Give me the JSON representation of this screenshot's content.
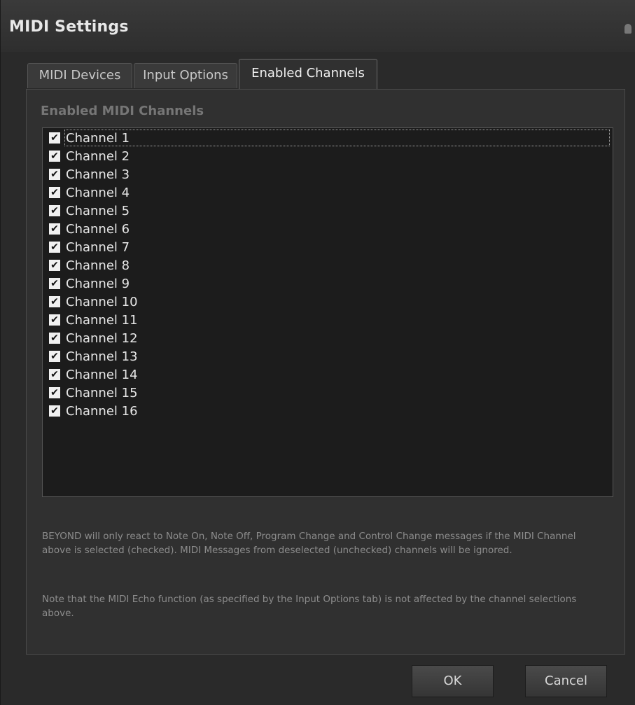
{
  "window": {
    "title": "MIDI Settings"
  },
  "tabs": [
    {
      "label": "MIDI Devices"
    },
    {
      "label": "Input Options"
    },
    {
      "label": "Enabled Channels"
    }
  ],
  "group": {
    "title": "Enabled MIDI Channels"
  },
  "channels": [
    {
      "label": "Channel 1",
      "checked": true
    },
    {
      "label": "Channel 2",
      "checked": true
    },
    {
      "label": "Channel 3",
      "checked": true
    },
    {
      "label": "Channel 4",
      "checked": true
    },
    {
      "label": "Channel 5",
      "checked": true
    },
    {
      "label": "Channel 6",
      "checked": true
    },
    {
      "label": "Channel 7",
      "checked": true
    },
    {
      "label": "Channel 8",
      "checked": true
    },
    {
      "label": "Channel 9",
      "checked": true
    },
    {
      "label": "Channel 10",
      "checked": true
    },
    {
      "label": "Channel 11",
      "checked": true
    },
    {
      "label": "Channel 12",
      "checked": true
    },
    {
      "label": "Channel 13",
      "checked": true
    },
    {
      "label": "Channel 14",
      "checked": true
    },
    {
      "label": "Channel 15",
      "checked": true
    },
    {
      "label": "Channel 16",
      "checked": true
    }
  ],
  "help": {
    "para1": "BEYOND will only react to Note On, Note Off, Program Change and Control Change messages if the MIDI Channel above is selected (checked). MIDI Messages from  deselected (unchecked) channels will be ignored.",
    "para2": "Note that the MIDI Echo function (as specified by the Input Options tab) is not affected by the channel selections above."
  },
  "buttons": {
    "ok": "OK",
    "cancel": "Cancel"
  },
  "icons": {
    "pin": "pin-icon",
    "check": "checkmark-icon"
  }
}
